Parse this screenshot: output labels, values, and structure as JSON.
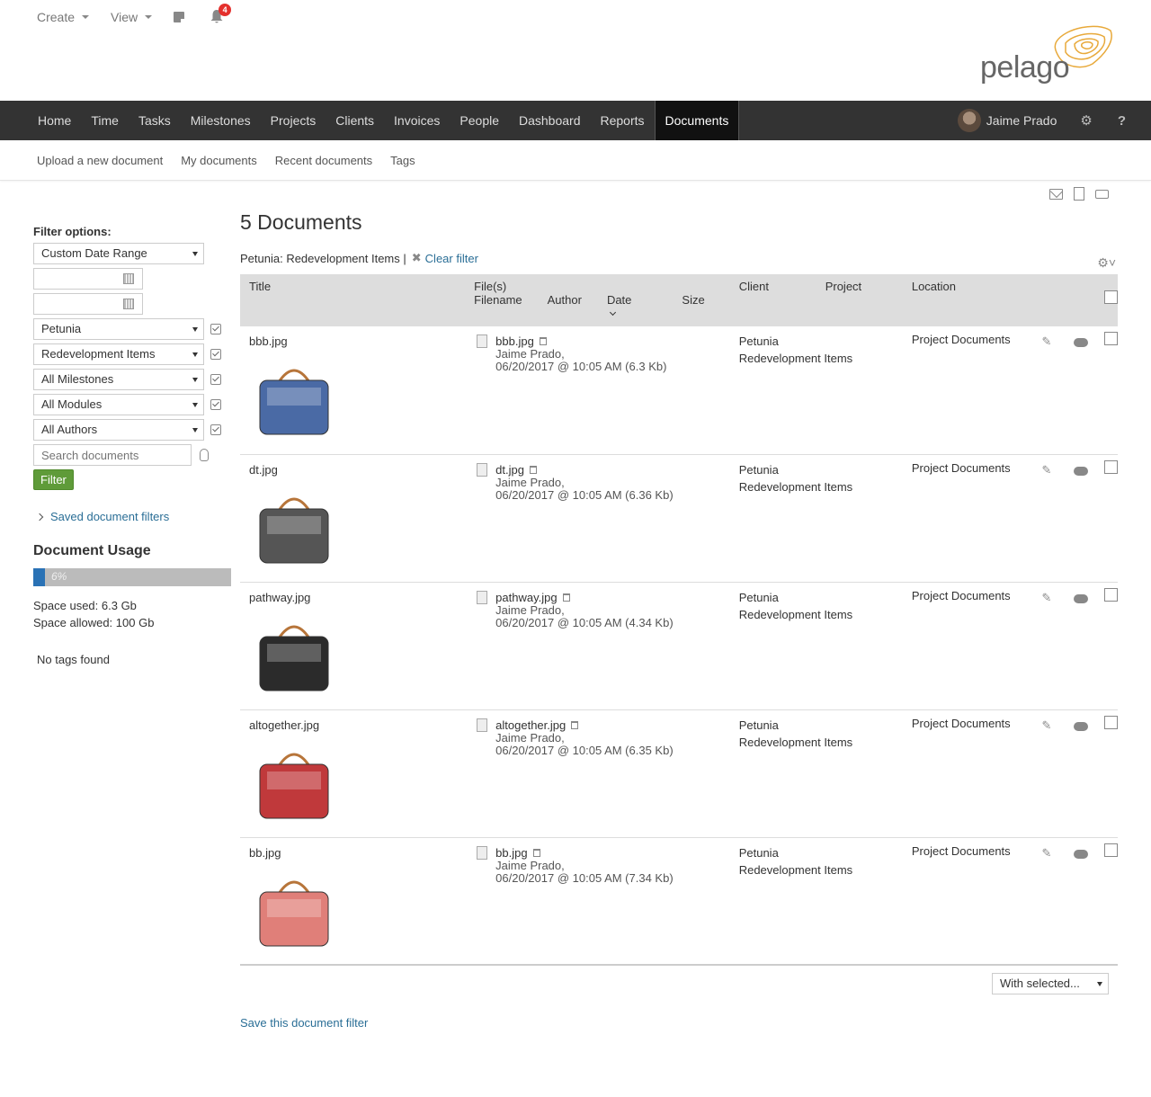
{
  "top": {
    "create_label": "Create",
    "view_label": "View",
    "notification_count": "4",
    "logo_text": "pelago"
  },
  "nav": {
    "items": [
      "Home",
      "Time",
      "Tasks",
      "Milestones",
      "Projects",
      "Clients",
      "Invoices",
      "People",
      "Dashboard",
      "Reports",
      "Documents"
    ],
    "active": "Documents",
    "user_name": "Jaime Prado",
    "help_label": "?"
  },
  "subnav": {
    "items": [
      "Upload a new document",
      "My documents",
      "Recent documents",
      "Tags"
    ]
  },
  "sidebar": {
    "filter_title": "Filter options:",
    "date_range": "Custom Date Range",
    "client": "Petunia",
    "project": "Redevelopment Items",
    "milestones": "All Milestones",
    "modules": "All Modules",
    "authors": "All Authors",
    "search_placeholder": "Search documents",
    "filter_button": "Filter",
    "saved_filters": "Saved document filters",
    "usage_title": "Document Usage",
    "usage_percent": 6,
    "usage_label": "6%",
    "space_used": "Space used: 6.3 Gb",
    "space_allowed": "Space allowed: 100 Gb",
    "tags_text": "No tags found"
  },
  "main": {
    "heading": "5 Documents",
    "filter_text": "Petunia: Redevelopment Items |",
    "clear_filter": "Clear filter",
    "columns": {
      "title": "Title",
      "files": "File(s)",
      "filename": "Filename",
      "author": "Author",
      "date": "Date",
      "size": "Size",
      "client": "Client",
      "project": "Project",
      "location": "Location"
    },
    "rows": [
      {
        "title": "bbb.jpg",
        "filename": "bbb.jpg",
        "author": "Jaime Prado,",
        "date_size": "06/20/2017 @ 10:05 AM (6.3 Kb)",
        "client": "Petunia",
        "project": "Redevelopment Items",
        "location": "Project Documents",
        "color": "#4a6aa5"
      },
      {
        "title": "dt.jpg",
        "filename": "dt.jpg",
        "author": "Jaime Prado,",
        "date_size": "06/20/2017 @ 10:05 AM (6.36 Kb)",
        "client": "Petunia",
        "project": "Redevelopment Items",
        "location": "Project Documents",
        "color": "#555555"
      },
      {
        "title": "pathway.jpg",
        "filename": "pathway.jpg",
        "author": "Jaime Prado,",
        "date_size": "06/20/2017 @ 10:05 AM (4.34 Kb)",
        "client": "Petunia",
        "project": "Redevelopment Items",
        "location": "Project Documents",
        "color": "#2b2b2b"
      },
      {
        "title": "altogether.jpg",
        "filename": "altogether.jpg",
        "author": "Jaime Prado,",
        "date_size": "06/20/2017 @ 10:05 AM (6.35 Kb)",
        "client": "Petunia",
        "project": "Redevelopment Items",
        "location": "Project Documents",
        "color": "#c0393b"
      },
      {
        "title": "bb.jpg",
        "filename": "bb.jpg",
        "author": "Jaime Prado,",
        "date_size": "06/20/2017 @ 10:05 AM (7.34 Kb)",
        "client": "Petunia",
        "project": "Redevelopment Items",
        "location": "Project Documents",
        "color": "#e07f79"
      }
    ],
    "with_selected": "With selected...",
    "save_filter": "Save this document filter"
  },
  "colors": {
    "nav_bg": "#333333",
    "nav_active_bg": "#111111",
    "link": "#2a6e96",
    "filter_button": "#5f9b39",
    "usage_bar": "#2a72b5",
    "logo_accent": "#e8a93a"
  }
}
